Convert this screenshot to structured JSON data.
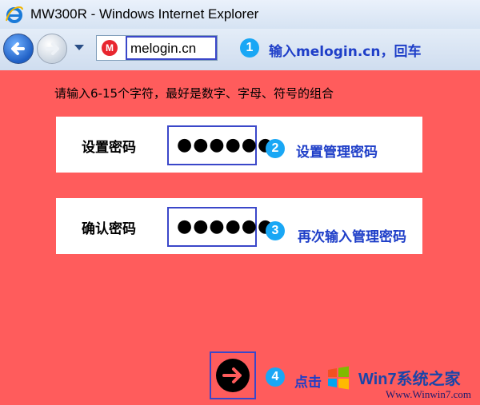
{
  "window": {
    "title": "MW300R - Windows Internet Explorer"
  },
  "address_bar": {
    "url": "melogin.cn",
    "site_icon": "M"
  },
  "steps": [
    {
      "number": "1",
      "text": "输入melogin.cn，回车"
    },
    {
      "number": "2",
      "text": "设置管理密码"
    },
    {
      "number": "3",
      "text": "再次输入管理密码"
    },
    {
      "number": "4",
      "text": "点击"
    }
  ],
  "form": {
    "hint": "请输入6-15个字符，最好是数字、字母、符号的组合",
    "set_password_label": "设置密码",
    "set_password_value": "●●●●●●",
    "confirm_password_label": "确认密码",
    "confirm_password_value": "●●●●●●"
  },
  "watermark": {
    "name": "Win7系统之家",
    "url": "Www.Winwin7.com"
  },
  "colors": {
    "page_bg": "#ff5c5c",
    "highlight_border": "#3a47c9",
    "bubble": "#19a7f5",
    "note_text": "#1e3ec8"
  }
}
